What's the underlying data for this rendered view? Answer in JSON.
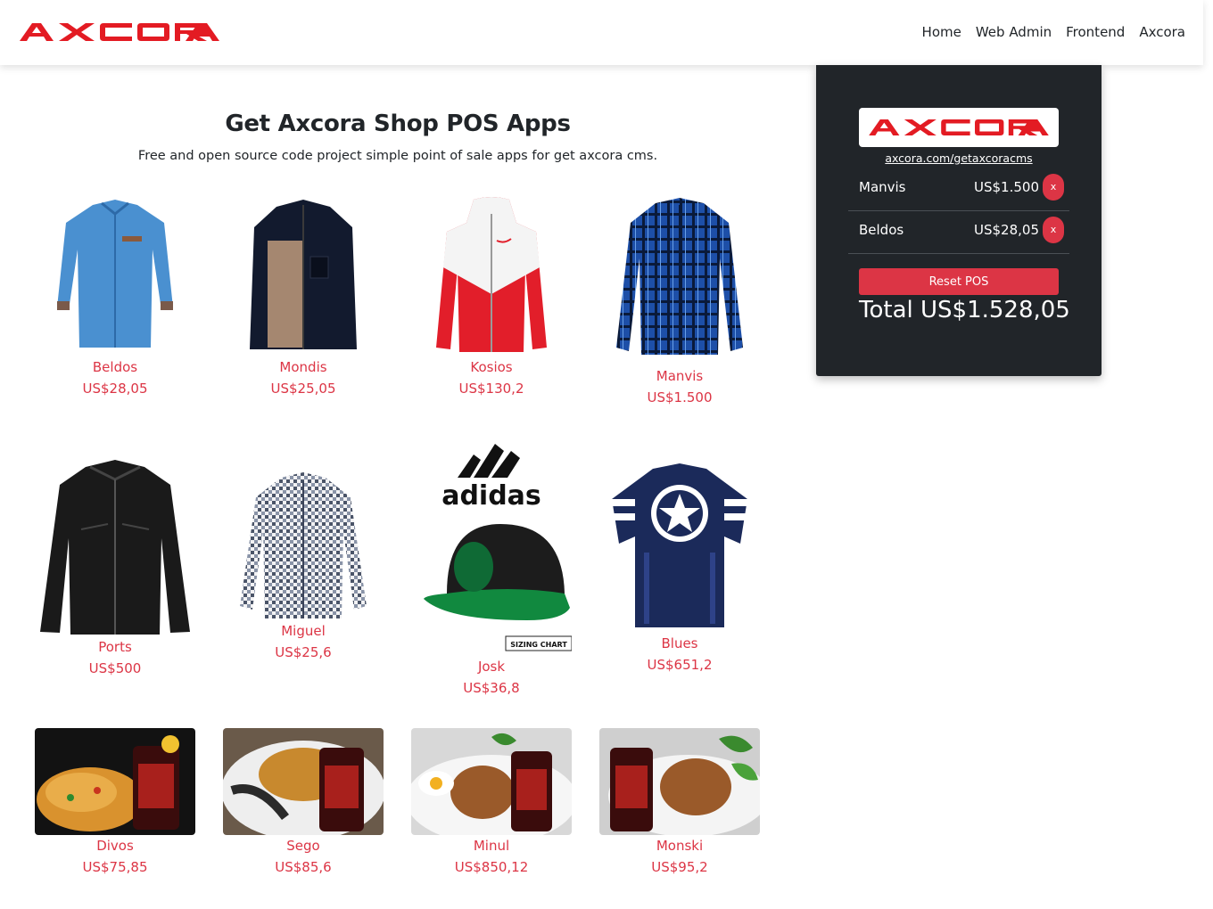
{
  "brand": {
    "name": "AXCORA",
    "color": "#e31b23",
    "logo_icon": "axcora-logo"
  },
  "nav": {
    "links": [
      "Home",
      "Web Admin",
      "Frontend",
      "Axcora"
    ]
  },
  "hero": {
    "title": "Get Axcora Shop POS Apps",
    "subtitle": "Free and open source code project simple point of sale apps for get axcora cms."
  },
  "products": [
    {
      "name": "Beldos",
      "price": "US$28,05",
      "image": "blue-shirt"
    },
    {
      "name": "Mondis",
      "price": "US$25,05",
      "image": "brown-jacket"
    },
    {
      "name": "Kosios",
      "price": "US$130,2",
      "image": "red-windbreaker"
    },
    {
      "name": "Manvis",
      "price": "US$1.500",
      "image": "plaid-shirt"
    },
    {
      "name": "Ports",
      "price": "US$500",
      "image": "leather-jacket"
    },
    {
      "name": "Miguel",
      "price": "US$25,6",
      "image": "check-shirt"
    },
    {
      "name": "Josk",
      "price": "US$36,8",
      "image": "adidas-cap",
      "image_text": [
        "adidas",
        "SIZING CHART"
      ]
    },
    {
      "name": "Blues",
      "price": "US$651,2",
      "image": "star-tshirt"
    },
    {
      "name": "Divos",
      "price": "US$75,85",
      "image": "fried-rice-cola"
    },
    {
      "name": "Sego",
      "price": "US$85,6",
      "image": "noodles-cola"
    },
    {
      "name": "Minul",
      "price": "US$850,12",
      "image": "rice-egg-cola"
    },
    {
      "name": "Monski",
      "price": "US$95,2",
      "image": "rice-plate-cola"
    }
  ],
  "pos": {
    "link": "axcora.com/getaxcoracms",
    "cart": [
      {
        "name": "Manvis",
        "price": "US$1.500",
        "remove": "x"
      },
      {
        "name": "Beldos",
        "price": "US$28,05",
        "remove": "x"
      }
    ],
    "reset_label": "Reset POS",
    "total": "Total US$1.528,05"
  },
  "colors": {
    "accent": "#dc3545",
    "panel": "#212529"
  }
}
